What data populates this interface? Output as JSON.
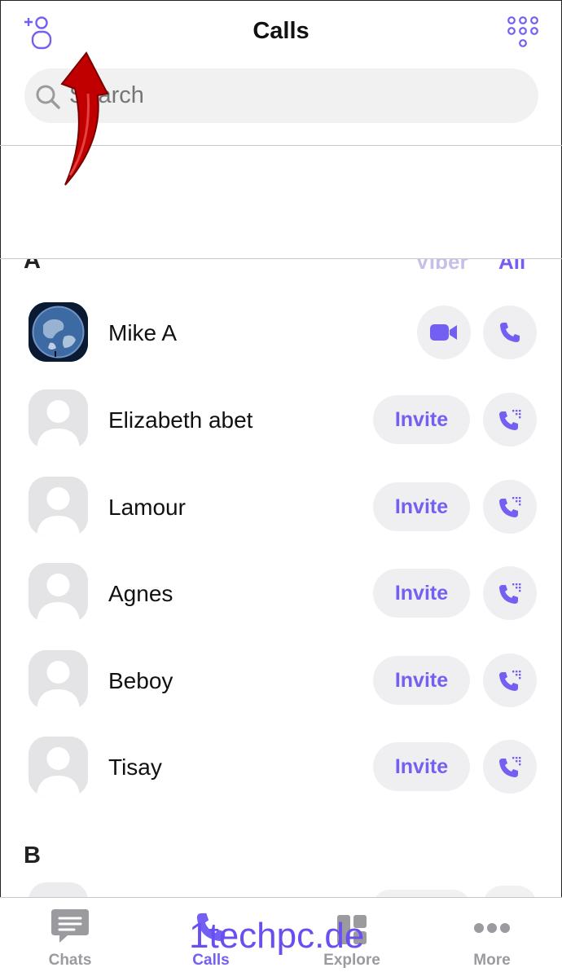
{
  "header": {
    "title": "Calls",
    "add_contact_icon": "add-contact-icon",
    "keypad_icon": "keypad-icon"
  },
  "search": {
    "placeholder": "Search"
  },
  "section_a": {
    "letter": "A",
    "filter_viber": "Viber",
    "filter_all": "All"
  },
  "contacts": [
    {
      "name": "Mike A",
      "avatar": "earth-photo",
      "action": "video-call"
    },
    {
      "name": "Elizabeth abet",
      "avatar": "placeholder",
      "action": "Invite"
    },
    {
      "name": "Lamour",
      "avatar": "placeholder",
      "action": "Invite"
    },
    {
      "name": "Agnes",
      "avatar": "placeholder",
      "action": "Invite"
    },
    {
      "name": "Beboy",
      "avatar": "placeholder",
      "action": "Invite"
    },
    {
      "name": "Tisay",
      "avatar": "placeholder",
      "action": "Invite"
    }
  ],
  "invite_label": "Invite",
  "section_b": {
    "letter": "B"
  },
  "tabs": [
    {
      "label": "Chats",
      "icon": "chat-bubble-icon",
      "active": false
    },
    {
      "label": "Calls",
      "icon": "phone-icon",
      "active": true
    },
    {
      "label": "Explore",
      "icon": "explore-icon",
      "active": false
    },
    {
      "label": "More",
      "icon": "more-dots-icon",
      "active": false
    }
  ],
  "watermark": "1techpc.de",
  "colors": {
    "accent": "#7360f2",
    "annotation_arrow": "#c00000",
    "search_bg": "#f1f1f2"
  }
}
